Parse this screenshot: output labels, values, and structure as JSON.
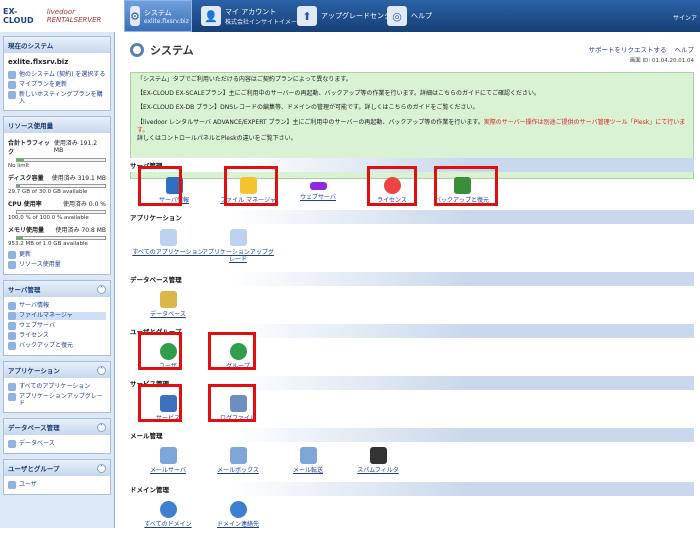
{
  "header": {
    "logo1": "EX-CLOUD",
    "logo2": "livedoor RENTALSERVER",
    "tabs": [
      {
        "t1": "システム",
        "t2": "exlite.flxsrv.biz"
      },
      {
        "t1": "マイ アカウント",
        "t2": "株式会社インサイトイメージ"
      },
      {
        "t1": "アップグレードセンター",
        "t2": ""
      },
      {
        "t1": "ヘルプ",
        "t2": ""
      }
    ],
    "signout": "サインア"
  },
  "sidebar": {
    "current_title": "現在のシステム",
    "site": "exlite.flxsrv.biz",
    "current_links": [
      "他のシステム (契約) を選択する",
      "マイプランを更新",
      "新しいホスティングプランを購入"
    ],
    "resource_title": "リソース使用量",
    "resources": [
      {
        "name": "合計トラフィック",
        "used": "使用済み 191.2 MB",
        "sub": "No limit",
        "pct": 0.08
      },
      {
        "name": "ディスク容量",
        "used": "使用済み 319.1 MB",
        "sub": "29.7 GB of 30.0 GB available",
        "pct": 0.03
      },
      {
        "name": "CPU 使用率",
        "used": "使用済み 0.0 %",
        "sub": "100.0 % of 100.0 % available",
        "pct": 0
      },
      {
        "name": "メモリ使用量",
        "used": "使用済み 70.8 MB",
        "sub": "953.2 MB of 1.0 GB available",
        "pct": 0.07
      }
    ],
    "resource_links": [
      "更新",
      "リソース使用量"
    ],
    "server_title": "サーバ管理",
    "server_links": [
      "サーバ情報",
      "ファイルマネージャ",
      "ウェブサーバ",
      "ライセンス",
      "バックアップと復元"
    ],
    "app_title": "アプリケーション",
    "app_links": [
      "すべてのアプリケーション",
      "アプリケーションアップグレード"
    ],
    "db_title": "データベース管理",
    "db_links": [
      "データベース"
    ],
    "user_title": "ユーザとグループ",
    "user_links": [
      "ユーザ"
    ]
  },
  "main": {
    "title": "システム",
    "request": "サポートをリクエストする",
    "help": "ヘルプ",
    "screen_id": "画面 ID: 01.04.20.01.04",
    "info": [
      "「システム」タブでご利用いただける内容はご契約プランによって異なります。",
      "【EX-CLOUD EX-SCALEプラン】主にご利用中のサーバーの再起動、バックアップ等の作業を行います。詳細はこちらのガイドにてご確認ください。",
      "【EX-CLOUD EX-DB プラン】DNSレコードの編集等、ドメインの管理が可能です。詳しくはこちらのガイドをご覧ください。",
      "【livedoor レンタルサーバ ADVANCE/EXPERT プラン】主にご利用中のサーバーの再起動、バックアップ等の作業を行います。",
      "実際のサーバー操作は別途ご提供のサーバ管理ツール「Plesk」にて行います。",
      "詳しくはコントロールパネルとPleskの違いをご覧下さい。"
    ],
    "sections": [
      {
        "title": "サーバ管理",
        "items": [
          "サーバ情報",
          "ファイル マネージャ",
          "ウェブサーバ",
          "ライセンス",
          "バックアップと復元"
        ]
      },
      {
        "title": "アプリケーション",
        "items": [
          "すべてのアプリケーション",
          "アプリケーションアップグレード"
        ]
      },
      {
        "title": "データベース管理",
        "items": [
          "データベース"
        ]
      },
      {
        "title": "ユーザとグループ",
        "items": [
          "ユーザ",
          "グループ"
        ]
      },
      {
        "title": "サービス管理",
        "items": [
          "サービス",
          "ログファイル"
        ]
      },
      {
        "title": "メール管理",
        "items": [
          "メールサーバ",
          "メールボックス",
          "メール転送",
          "スパムフィルタ"
        ]
      },
      {
        "title": "ドメイン管理",
        "items": [
          "すべてのドメイン",
          "ドメイン連絡先"
        ]
      }
    ]
  }
}
